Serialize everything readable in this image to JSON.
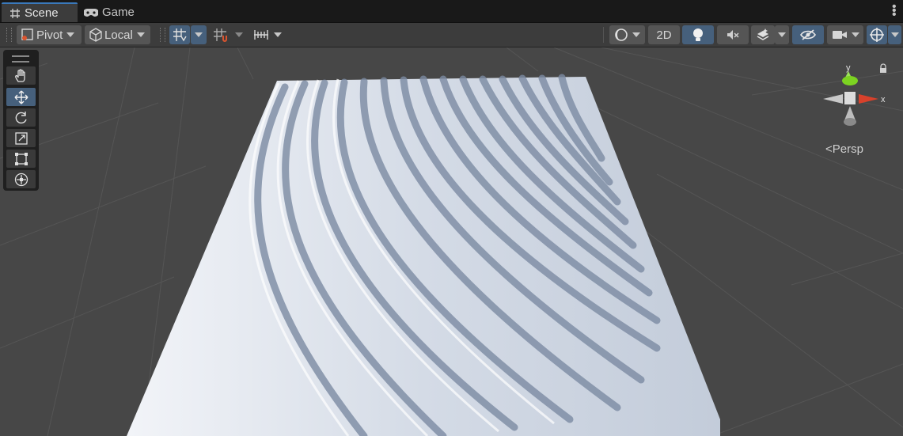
{
  "tabs": [
    {
      "label": "Scene",
      "icon": "grid-hash-icon",
      "active": true
    },
    {
      "label": "Game",
      "icon": "gamepad-icon",
      "active": false
    }
  ],
  "toolbar": {
    "pivot_label": "Pivot",
    "local_label": "Local",
    "twod_label": "2D"
  },
  "viewport": {
    "projection_label": "Persp",
    "gizmo_axes": {
      "x": "x",
      "y": "y"
    }
  },
  "tools": [
    "hand-tool",
    "move-tool",
    "rotate-tool",
    "scale-tool",
    "rect-tool",
    "transform-tool"
  ],
  "colors": {
    "accent_blue": "#46607c",
    "tab_highlight": "#3a79bb",
    "x_axis": "#d8412b",
    "y_axis": "#7cd321"
  }
}
